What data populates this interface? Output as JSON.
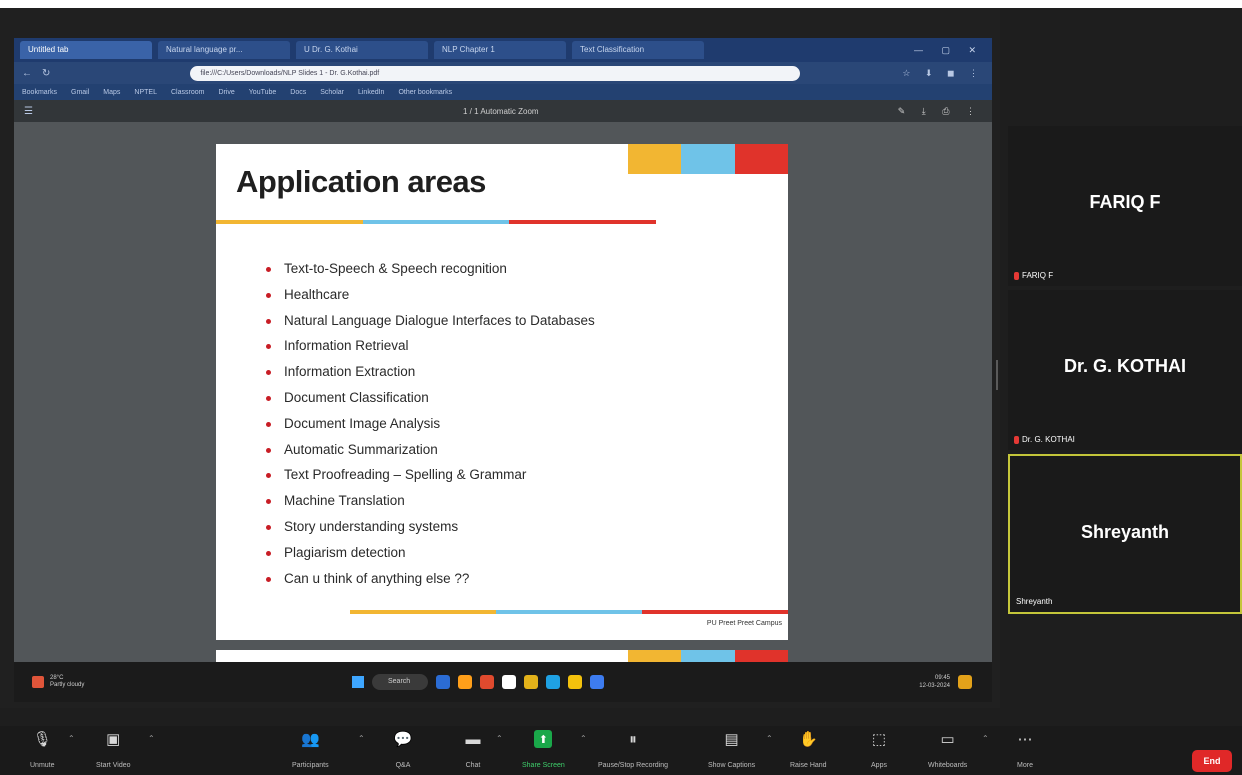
{
  "browser": {
    "tabs": [
      {
        "label": "Untitled tab",
        "active": true
      },
      {
        "label": "Natural language pr..."
      },
      {
        "label": "U Dr. G. Kothai"
      },
      {
        "label": "NLP Chapter 1"
      },
      {
        "label": "Text Classification"
      }
    ],
    "address": "file:///C:/Users/Downloads/NLP Slides 1 - Dr. G.Kothai.pdf",
    "bookmarks": [
      "Bookmarks",
      "Gmail",
      "Maps",
      "NPTEL",
      "Classroom",
      "Drive",
      "YouTube",
      "Docs",
      "Scholar",
      "LinkedIn",
      "Other bookmarks"
    ],
    "pdf_page_indicator": "1 / 1  Automatic Zoom"
  },
  "slide": {
    "title": "Application areas",
    "bullets": [
      "Text-to-Speech & Speech recognition",
      "Healthcare",
      "Natural Language Dialogue Interfaces to Databases",
      "Information Retrieval",
      "Information Extraction",
      "Document Classification",
      "Document Image Analysis",
      "Automatic Summarization",
      "Text Proofreading – Spelling & Grammar",
      "Machine Translation",
      "Story understanding systems",
      "Plagiarism detection",
      "Can u think of anything else ??"
    ],
    "footer": "PU Preet   Preet Campus",
    "accent_colors": [
      "#f2b632",
      "#6fc3e8",
      "#e0332b"
    ]
  },
  "taskbar": {
    "weather": "28°C\nPartly cloudy",
    "search_label": "Search",
    "clock": "09:45\n12-03-2024",
    "app_colors": [
      "#2b6cd4",
      "#ff9f1a",
      "#e04a2e",
      "#ffffff",
      "#e3b21a",
      "#1fa1e3",
      "#f4c20d",
      "#3d7cf0"
    ]
  },
  "participants": [
    {
      "display_name": "FARIQ F",
      "label": "FARIQ F",
      "muted": true
    },
    {
      "display_name": "Dr. G. KOTHAI",
      "label": "Dr. G. KOTHAI",
      "muted": true
    },
    {
      "display_name": "Shreyanth",
      "label": "Shreyanth",
      "muted": false,
      "active_speaker": true
    }
  ],
  "controls": {
    "unmute": "Unmute",
    "start_video": "Start Video",
    "participants": "Participants",
    "qa": "Q&A",
    "chat": "Chat",
    "share_screen": "Share Screen",
    "pause_recording": "Pause/Stop Recording",
    "show_captions": "Show Captions",
    "raise_hand": "Raise Hand",
    "apps": "Apps",
    "whiteboards": "Whiteboards",
    "more": "More",
    "end": "End"
  }
}
